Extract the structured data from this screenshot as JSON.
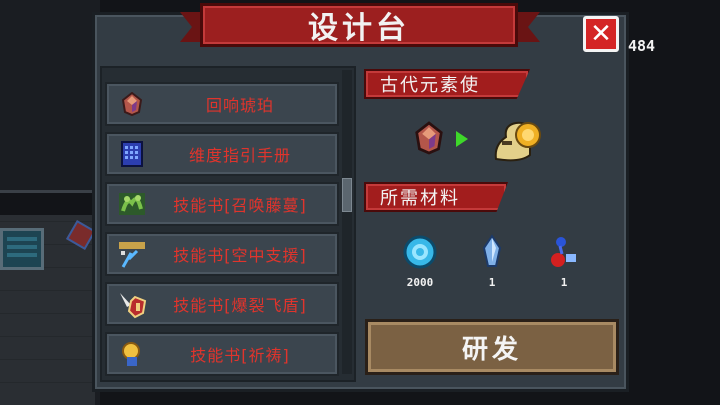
{
  "title": "设计台",
  "counter": "484",
  "recipes": [
    {
      "label": "回响琥珀",
      "icon": "amber-gem-icon"
    },
    {
      "label": "维度指引手册",
      "icon": "dimension-manual-icon"
    },
    {
      "label": "技能书[召唤藤蔓]",
      "icon": "vine-summon-book-icon"
    },
    {
      "label": "技能书[空中支援]",
      "icon": "air-support-book-icon"
    },
    {
      "label": "技能书[爆裂飞盾]",
      "icon": "burst-shield-book-icon"
    },
    {
      "label": "技能书[祈祷]",
      "icon": "prayer-book-icon"
    }
  ],
  "selected": {
    "header": "古代元素使",
    "input_icon": "amber-gem-icon",
    "arrow_icon": "green-arrow-icon",
    "output_icon": "ancient-elementalist-icon"
  },
  "materials_header": "所需材料",
  "materials": [
    {
      "icon": "blue-gem-coin-icon",
      "count": "2000"
    },
    {
      "icon": "crystal-shard-icon",
      "count": "1"
    },
    {
      "icon": "elemental-orb-icon",
      "count": "1"
    }
  ],
  "forge_label": "研发",
  "colors": {
    "recipe_text": "#e0342c",
    "header_red": "#a21d1d",
    "forge_brown": "#7b6143",
    "close_red": "#d42525"
  }
}
